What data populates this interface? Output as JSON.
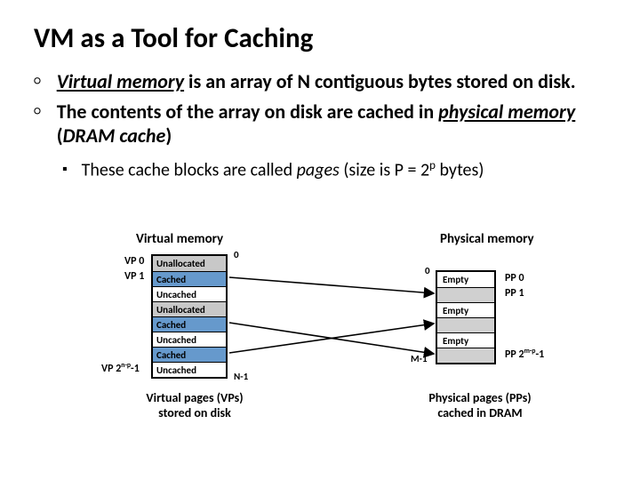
{
  "title": "VM as a Tool for Caching",
  "bullets": {
    "b1a_pre": "Virtual memory",
    "b1a_post": " is an array of N contiguous bytes stored on disk.",
    "b1b_pre": "The contents of the array on disk are cached in ",
    "b1b_mid": "physical memory",
    "b1b_paren_open": " (",
    "b1b_dram": "DRAM cache",
    "b1b_paren_close": ")",
    "b2_pre": "These cache blocks are called ",
    "b2_pages": "pages",
    "b2_size_open": " (size is P = 2",
    "b2_exp": "p",
    "b2_size_close": " bytes)"
  },
  "diagram": {
    "vm_heading": "Virtual memory",
    "pm_heading": "Physical memory",
    "vm_rows": [
      "Unallocated",
      "Cached",
      "Uncached",
      "Unallocated",
      "Cached",
      "Uncached",
      "Cached",
      "Uncached"
    ],
    "pm_rows_labels": [
      "Empty",
      "",
      "Empty",
      "",
      "Empty",
      ""
    ],
    "vp0": "VP 0",
    "vp1": "VP 1",
    "vp_last_pre": "VP 2",
    "vp_last_exp": "n-p",
    "vp_last_post": "-1",
    "pp0": "PP 0",
    "pp1": "PP 1",
    "pp_last_pre": "PP 2",
    "pp_last_exp": "m-p",
    "pp_last_post": "-1",
    "idx0_vm": "0",
    "idxN_vm": "N-1",
    "idx0_pm": "0",
    "idxM_pm": "M-1",
    "vm_caption_l1": "Virtual pages (VPs)",
    "vm_caption_l2": "stored on disk",
    "pm_caption_l1": "Physical pages (PPs)",
    "pm_caption_l2": "cached in DRAM"
  }
}
